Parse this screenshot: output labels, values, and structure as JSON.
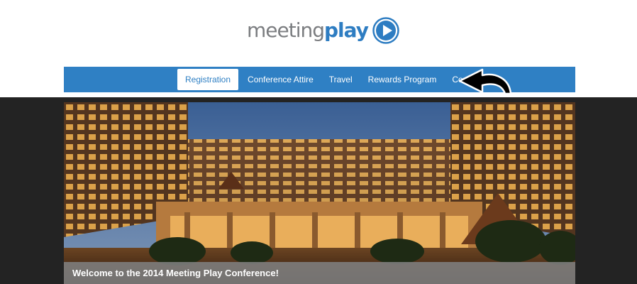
{
  "logo": {
    "word_a": "meeting",
    "word_b": "play",
    "icon": "play-circle-icon",
    "colors": {
      "gray": "#7b7d80",
      "blue": "#2e7dc2"
    }
  },
  "nav": {
    "items": [
      {
        "label": "Registration",
        "active": true
      },
      {
        "label": "Conference Attire",
        "active": false
      },
      {
        "label": "Travel",
        "active": false
      },
      {
        "label": "Rewards Program",
        "active": false
      },
      {
        "label": "Contact",
        "active": false
      }
    ],
    "color": "#2f80c4"
  },
  "annotation": {
    "icon": "curved-arrow-icon"
  },
  "hero": {
    "image": "hotel-courtyard-photo",
    "caption": "Welcome to the 2014 Meeting Play Conference!"
  }
}
